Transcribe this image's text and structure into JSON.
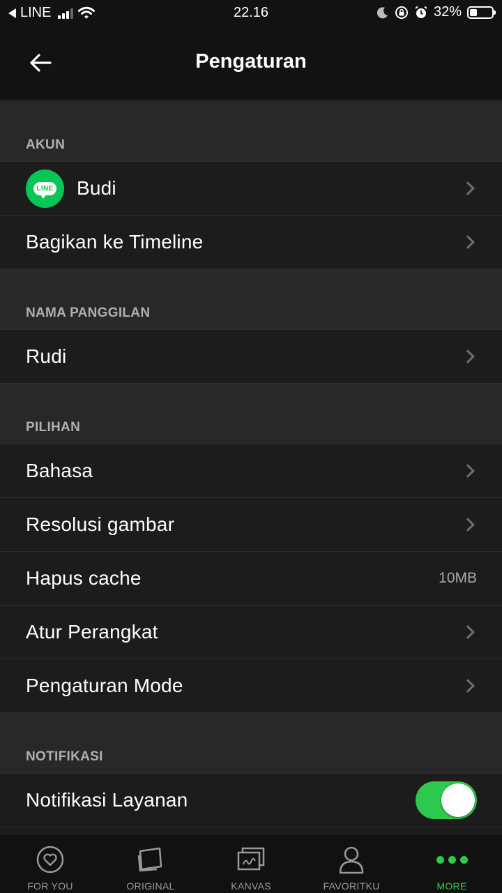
{
  "status_bar": {
    "carrier": "LINE",
    "time": "22.16",
    "battery": "32%",
    "battery_level": 0.32
  },
  "header": {
    "title": "Pengaturan"
  },
  "sections": {
    "akun": {
      "title": "AKUN",
      "account_name": "Budi",
      "share_timeline": "Bagikan ke Timeline",
      "logo_text": "LINE"
    },
    "nickname": {
      "title": "NAMA PANGGILAN",
      "value": "Rudi"
    },
    "options": {
      "title": "PILIHAN",
      "language": "Bahasa",
      "image_resolution": "Resolusi gambar",
      "clear_cache": "Hapus cache",
      "cache_size": "10MB",
      "device_settings": "Atur Perangkat",
      "mode_settings": "Pengaturan Mode"
    },
    "notifications": {
      "title": "NOTIFIKASI",
      "service_notifications": "Notifikasi Layanan",
      "service_notifications_on": true
    }
  },
  "bottom_nav": {
    "for_you": "FOR YOU",
    "original": "ORIGINAL",
    "kanvas": "KANVAS",
    "favoritku": "FAVORITKU",
    "more": "MORE"
  },
  "colors": {
    "accent": "#2dc84d",
    "line_green": "#06c755",
    "background": "#1c1c1c",
    "section_bg": "#282828"
  }
}
